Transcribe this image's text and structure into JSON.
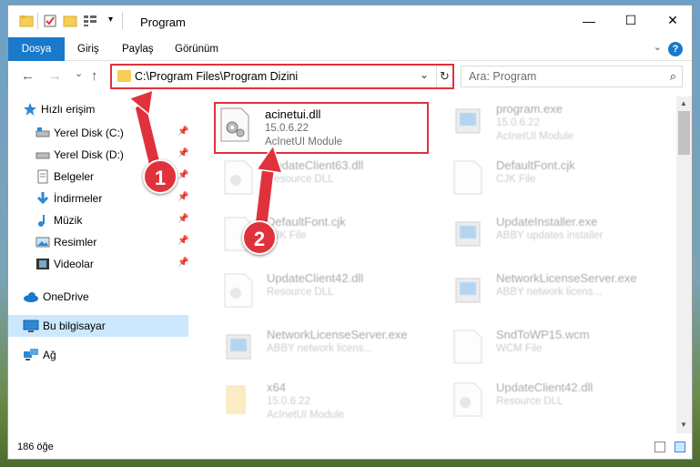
{
  "window": {
    "title": "Program",
    "controls": {
      "minimize": "—",
      "maximize": "☐",
      "close": "✕"
    }
  },
  "ribbon": {
    "tabs": [
      "Dosya",
      "Giriş",
      "Paylaş",
      "Görünüm"
    ],
    "help": "?"
  },
  "nav": {
    "back": "←",
    "forward": "→",
    "recent": "⌄",
    "up": "↑",
    "address": "C:\\Program Files\\Program Dizini",
    "dropdown": "⌄",
    "refresh": "↻",
    "search_placeholder": "Ara: Program",
    "search_icon": "⌕"
  },
  "sidebar": {
    "quick_access": "Hızlı erişim",
    "items": [
      {
        "label": "Yerel Disk (C:)",
        "icon": "drive-icon",
        "pinned": true
      },
      {
        "label": "Yerel Disk (D:)",
        "icon": "drive-icon",
        "pinned": true
      },
      {
        "label": "Belgeler",
        "icon": "documents-icon",
        "pinned": true
      },
      {
        "label": "İndirmeler",
        "icon": "downloads-icon",
        "pinned": true
      },
      {
        "label": "Müzik",
        "icon": "music-icon",
        "pinned": true
      },
      {
        "label": "Resimler",
        "icon": "pictures-icon",
        "pinned": true
      },
      {
        "label": "Videolar",
        "icon": "videos-icon",
        "pinned": true
      }
    ],
    "onedrive": "OneDrive",
    "this_pc": "Bu bilgisayar",
    "network": "Ağ"
  },
  "files": [
    {
      "name": "acinetui.dll",
      "line1": "15.0.6.22",
      "line2": "AcInetUI Module",
      "highlighted": true
    },
    {
      "name": "program.exe",
      "line1": "15.0.6.22",
      "line2": "AcInetUI Module"
    },
    {
      "name": "UpdateClient63.dll",
      "line1": "Resource DLL"
    },
    {
      "name": "DefaultFont.cjk",
      "line1": "CJK File"
    },
    {
      "name": "DefaultFont.cjk",
      "line1": "CJK File"
    },
    {
      "name": "UpdateInstaller.exe",
      "line1": "ABBY updates installer"
    },
    {
      "name": "UpdateClient42.dll",
      "line1": "Resource DLL"
    },
    {
      "name": "NetworkLicenseServer.exe",
      "line1": "ABBY network licens..."
    },
    {
      "name": "NetworkLicenseServer.exe",
      "line1": "ABBY network licens..."
    },
    {
      "name": "SndToWP15.wcm",
      "line1": "WCM File"
    },
    {
      "name": "x64",
      "line1": "15.0.6.22",
      "line2": "AcInetUI Module"
    },
    {
      "name": "UpdateClient42.dll",
      "line1": "Resource DLL"
    }
  ],
  "status": {
    "count": "186 öğe"
  },
  "callouts": [
    "1",
    "2"
  ],
  "colors": {
    "accent": "#1979ca",
    "callout": "#e0323d",
    "selection": "#cce8ff"
  }
}
